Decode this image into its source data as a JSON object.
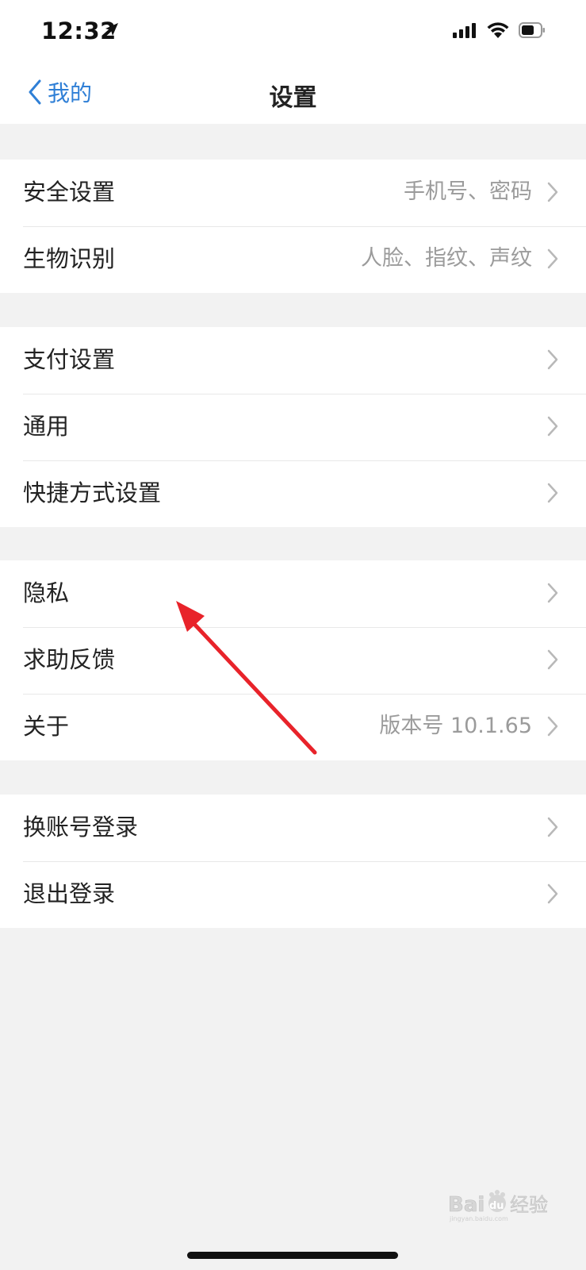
{
  "status_bar": {
    "time": "12:32",
    "icons": [
      "location-arrow-icon",
      "cellular-signal-icon",
      "wifi-icon",
      "battery-icon"
    ]
  },
  "nav": {
    "back_label": "我的",
    "title": "设置"
  },
  "groups": [
    {
      "rows": [
        {
          "label": "安全设置",
          "value": "手机号、密码"
        },
        {
          "label": "生物识别",
          "value": "人脸、指纹、声纹"
        }
      ]
    },
    {
      "rows": [
        {
          "label": "支付设置",
          "value": ""
        },
        {
          "label": "通用",
          "value": ""
        },
        {
          "label": "快捷方式设置",
          "value": ""
        }
      ]
    },
    {
      "rows": [
        {
          "label": "隐私",
          "value": ""
        },
        {
          "label": "求助反馈",
          "value": ""
        },
        {
          "label": "关于",
          "value": "版本号 10.1.65"
        }
      ]
    },
    {
      "rows": [
        {
          "label": "换账号登录",
          "value": ""
        },
        {
          "label": "退出登录",
          "value": ""
        }
      ]
    }
  ],
  "watermark": {
    "text_latin": "Bai",
    "text_du": "du",
    "text_cn": "经验",
    "subtext": "jingyan.baidu.com"
  },
  "colors": {
    "accent": "#2f7fd6",
    "background": "#f2f2f2",
    "annotation_arrow": "#e8232a"
  }
}
